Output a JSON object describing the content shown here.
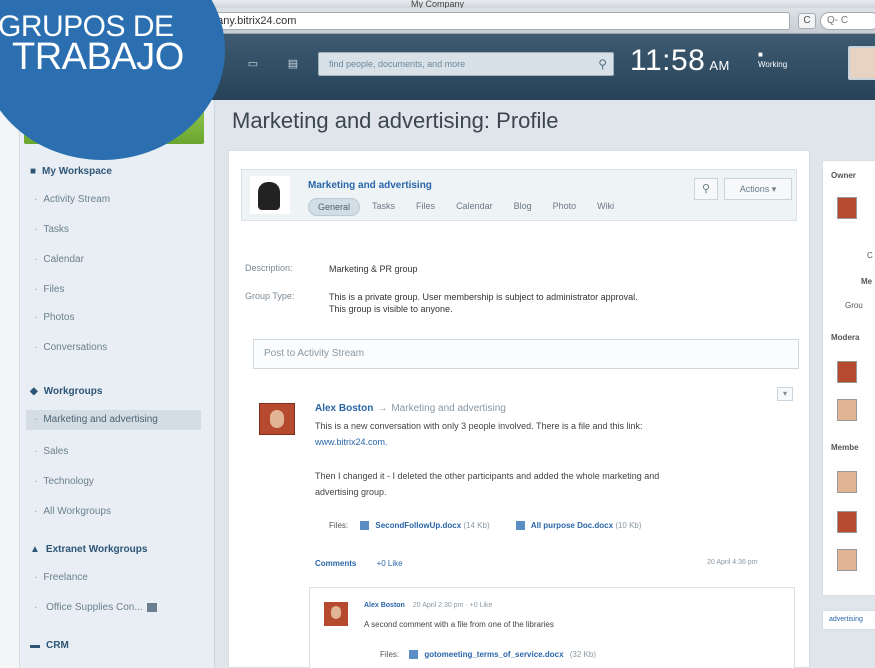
{
  "browser": {
    "window_title": "My Company",
    "url": "pany.bitrix24.com",
    "reload_icon": "C",
    "search_placeholder": "Q- C"
  },
  "header": {
    "search_placeholder": "find people, documents, and more",
    "time": "11:58",
    "ampm": "AM",
    "status": "Working"
  },
  "badge": {
    "line1": "GRUPOS DE",
    "line2": "TRABAJO"
  },
  "sidebar": {
    "workspace_title": "My Workspace",
    "workspace_items": [
      "Activity Stream",
      "Tasks",
      "Calendar",
      "Files",
      "Photos",
      "Conversations"
    ],
    "workgroups_title": "Workgroups",
    "workgroup_items": [
      "Marketing and advertising",
      "Sales",
      "Technology",
      "All Workgroups"
    ],
    "extranet_title": "Extranet Workgroups",
    "extranet_items": [
      "Freelance",
      "Office Supplies Con..."
    ],
    "crm_title": "CRM"
  },
  "page": {
    "title": "Marketing and advertising: Profile"
  },
  "group": {
    "name": "Marketing and advertising",
    "tabs": [
      "General",
      "Tasks",
      "Files",
      "Calendar",
      "Blog",
      "Photo",
      "Wiki"
    ],
    "actions_label": "Actions",
    "description_label": "Description:",
    "description": "Marketing & PR group",
    "type_label": "Group Type:",
    "type_line1": "This is a private group. User membership is subject to administrator approval.",
    "type_line2": "This group is visible to anyone."
  },
  "stream": {
    "post_placeholder": "Post to Activity Stream",
    "post": {
      "author": "Alex Boston",
      "group": "Marketing and advertising",
      "line1": "This is a new conversation with only 3 people involved.  There is a file and this link:",
      "link": "www.bitrix24.com.",
      "line2": "Then I changed it - I deleted the other participants and added the whole marketing and",
      "line3": "advertising group.",
      "files_label": "Files:",
      "file1": "SecondFollowUp.docx",
      "file1_size": "(14 Kb)",
      "file2": "All purpose Doc.docx",
      "file2_size": "(10 Kb)",
      "comments_label": "Comments",
      "like_label": "+0 Like",
      "time": "20 April 4:36 pm"
    },
    "comment": {
      "author": "Alex Boston",
      "meta": "20 April 2:30 pm · +0 Like",
      "text": "A second comment with a file from one of the libraries",
      "files_label": "Files:",
      "file": "gotomeeting_terms_of_service.docx",
      "file_size": "(32 Kb)"
    }
  },
  "right_panel": {
    "owner_title": "Owner",
    "line_c": "C",
    "line_me": "Me",
    "line_grou": "Grou",
    "moderators_title": "Modera",
    "members_title": "Membe",
    "tag": "advertising"
  }
}
